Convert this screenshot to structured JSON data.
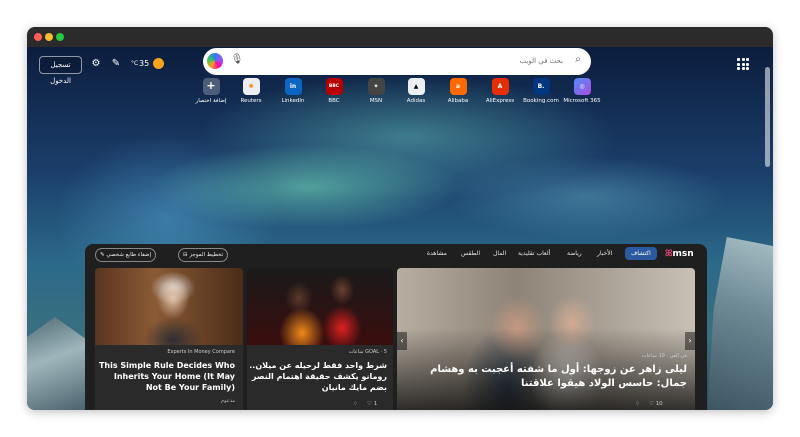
{
  "header": {
    "signin_label": "تسجيل الدخول",
    "temperature": "35",
    "temp_unit": "°C"
  },
  "search": {
    "placeholder": "بحث في الويب"
  },
  "quick_links": [
    {
      "label": "إضافة اختصار",
      "icon": "plus-icon",
      "color": "#6b7a80"
    },
    {
      "label": "Reuters",
      "icon": "reuters-logo",
      "color": "#ff8000"
    },
    {
      "label": "LinkedIn",
      "icon": "linkedin-logo",
      "color": "#0a66c2"
    },
    {
      "label": "BBC",
      "icon": "bbc-logo",
      "color": "#b80000"
    },
    {
      "label": "MSN",
      "icon": "msn-logo",
      "color": "#333333"
    },
    {
      "label": "Adidas",
      "icon": "adidas-logo",
      "color": "#000000"
    },
    {
      "label": "Alibaba",
      "icon": "alibaba-logo",
      "color": "#ff6a00"
    },
    {
      "label": "AliExpress",
      "icon": "aliexpress-logo",
      "color": "#e62e04"
    },
    {
      "label": "Booking.com",
      "icon": "booking-logo",
      "color": "#003580"
    },
    {
      "label": "Microsoft 365",
      "icon": "m365-logo",
      "color": "#7b4bd6"
    }
  ],
  "feed": {
    "brand": "msn",
    "tabs": [
      "اكتشاف",
      "الأخبار",
      "رياضة",
      "ألعاب تقليدية",
      "المال",
      "الطقس",
      "مشاهدة"
    ],
    "layout_label": "تخطيط الموجز",
    "personalize_label": "إضفاء طابع شخصي",
    "cards": [
      {
        "source": "في الفن",
        "time": "10 ساعات",
        "headline": "ليلى زاهر عن زوجها: أول ما شفته أعجبت به وهشام جمال: حاسس الولاد هيقوا علاقتنا",
        "likes": "10"
      },
      {
        "source": "GOAL",
        "time": "5 ساعات",
        "headline": "شرط واحد فقط لرحيله عن ميلان.. رومانو يكشف حقيقة اهتمام النصر بضم مايك مانيان",
        "likes": "1"
      },
      {
        "source": "Experts In Money Compare",
        "headline": "This Simple Rule Decides Who Inherits Your Home (It May Not Be Your Family)",
        "sponsored": "مدعوم"
      }
    ]
  },
  "colors": {
    "active_tab": "#2c5aa0",
    "feed_bg": "#1f1f1f"
  }
}
